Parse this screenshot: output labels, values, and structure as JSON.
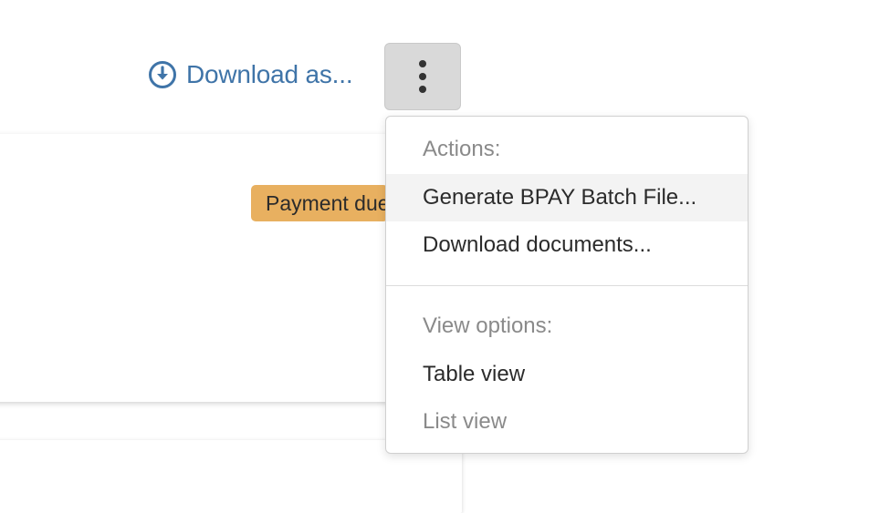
{
  "toolbar": {
    "download_label": "Download as...",
    "download_icon": "download-circle-icon",
    "more_icon": "kebab-vertical-icon"
  },
  "card": {
    "badge_text": "Payment due"
  },
  "menu": {
    "actions_heading": "Actions:",
    "actions": [
      {
        "label": "Generate BPAY Batch File..."
      },
      {
        "label": "Download documents..."
      }
    ],
    "view_heading": "View options:",
    "views": [
      {
        "label": "Table view"
      },
      {
        "label": "List view"
      }
    ]
  },
  "colors": {
    "link": "#3f74a8",
    "badge": "#e8b060",
    "button_bg": "#d9d9d9"
  }
}
